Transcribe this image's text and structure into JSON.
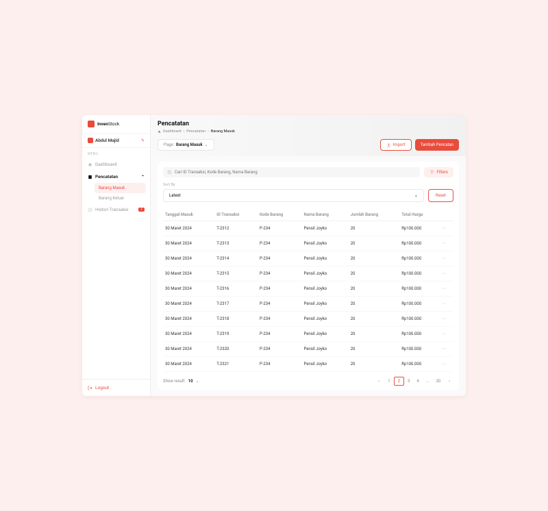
{
  "brand": {
    "name1": "Inven",
    "name2": "Stock"
  },
  "user": {
    "name": "Abdul Majid"
  },
  "menu": {
    "label": "MENU",
    "items": [
      {
        "label": "Dashboard"
      },
      {
        "label": "Pencatatan"
      },
      {
        "label": "Histori Transaksi",
        "badge": "1"
      }
    ],
    "sub": {
      "a": "Barang Masuk",
      "b": "Barang Keluar"
    }
  },
  "logout": "Logout",
  "page": {
    "title": "Pencatatan",
    "crumb": {
      "a": "Dashboard",
      "b": "Pencatatan",
      "c": "Barang Masuk"
    },
    "pageSel": {
      "label": "Page:",
      "value": "Barang Masuk"
    },
    "import": "Import",
    "add": "Tambah Pencatan"
  },
  "search": {
    "placeholder": "Cari ID Transaksi, Kode Barang, Nama Barang"
  },
  "filters": "Filters",
  "sortBy": "Sort By",
  "sortVal": "Latest",
  "reset": "Reset",
  "cols": {
    "a": "Tanggal Masuk",
    "b": "ID Transaksi",
    "c": "Kode Barang",
    "d": "Nama Barang",
    "e": "Jumlah Barang",
    "f": "Total Harga"
  },
  "rows": [
    {
      "date": "30 Maret 2024",
      "id": "T-2312",
      "code": "P-234",
      "name": "Pensil Joyko",
      "qty": "20",
      "total": "Rp100.000"
    },
    {
      "date": "30 Maret 2024",
      "id": "T-2313",
      "code": "P-234",
      "name": "Pensil Joyko",
      "qty": "20",
      "total": "Rp100.000"
    },
    {
      "date": "30 Maret 2024",
      "id": "T-2314",
      "code": "P-234",
      "name": "Pensil Joyko",
      "qty": "20",
      "total": "Rp100.000"
    },
    {
      "date": "30 Maret 2024",
      "id": "T-2315",
      "code": "P-234",
      "name": "Pensil Joyko",
      "qty": "20",
      "total": "Rp100.000"
    },
    {
      "date": "30 Maret 2024",
      "id": "T-2316",
      "code": "P-234",
      "name": "Pensil Joyko",
      "qty": "20",
      "total": "Rp100.000"
    },
    {
      "date": "30 Maret 2024",
      "id": "T-2317",
      "code": "P-234",
      "name": "Pensil Joyko",
      "qty": "20",
      "total": "Rp100.000"
    },
    {
      "date": "30 Maret 2024",
      "id": "T-2318",
      "code": "P-234",
      "name": "Pensil Joyko",
      "qty": "20",
      "total": "Rp100.000"
    },
    {
      "date": "30 Maret 2024",
      "id": "T-2319",
      "code": "P-234",
      "name": "Pensil Joyko",
      "qty": "20",
      "total": "Rp100.000"
    },
    {
      "date": "30 Maret 2024",
      "id": "T-2320",
      "code": "P-234",
      "name": "Pensil Joyko",
      "qty": "20",
      "total": "Rp100.000"
    },
    {
      "date": "30 Maret 2024",
      "id": "T-2321",
      "code": "P-234",
      "name": "Pensil Joyko",
      "qty": "20",
      "total": "Rp100.000"
    }
  ],
  "showResult": {
    "label": "Show result:",
    "value": "10"
  },
  "pages": [
    "1",
    "2",
    "3",
    "4",
    "...",
    "20"
  ]
}
